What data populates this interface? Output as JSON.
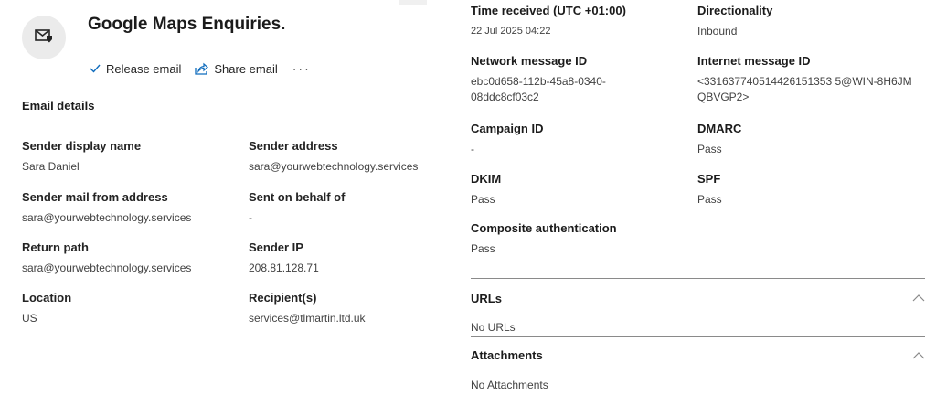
{
  "header": {
    "title": "Google Maps Enquiries.",
    "icon": "mail-shield-icon",
    "actions": {
      "release": "Release email",
      "share": "Share email",
      "more": "···"
    }
  },
  "email_details": {
    "heading": "Email details",
    "fields": {
      "sender_display_name": {
        "label": "Sender display name",
        "value": "Sara Daniel"
      },
      "sender_address": {
        "label": "Sender address",
        "value": "sara@yourwebtechnology.services"
      },
      "sender_mail_from": {
        "label": "Sender mail from address",
        "value": "sara@yourwebtechnology.services"
      },
      "sent_on_behalf": {
        "label": "Sent on behalf of",
        "value": "-"
      },
      "return_path": {
        "label": "Return path",
        "value": "sara@yourwebtechnology.services"
      },
      "sender_ip": {
        "label": "Sender IP",
        "value": "208.81.128.71"
      },
      "location": {
        "label": "Location",
        "value": "US"
      },
      "recipients": {
        "label": "Recipient(s)",
        "value": "services@tlmartin.ltd.uk"
      }
    }
  },
  "message_info": {
    "time_received": {
      "label": "Time received (UTC +01:00)",
      "value": "22 Jul 2025 04:22"
    },
    "directionality": {
      "label": "Directionality",
      "value": "Inbound"
    },
    "network_message_id": {
      "label": "Network message ID",
      "value": "ebc0d658-112b-45a8-0340-08ddc8cf03c2"
    },
    "internet_message_id": {
      "label": "Internet message ID",
      "value": "<331637740514426151353 5@WIN-8H6JMQBVGP2>"
    },
    "campaign_id": {
      "label": "Campaign ID",
      "value": "-"
    },
    "dmarc": {
      "label": "DMARC",
      "value": "Pass"
    },
    "dkim": {
      "label": "DKIM",
      "value": "Pass"
    },
    "spf": {
      "label": "SPF",
      "value": "Pass"
    },
    "composite_auth": {
      "label": "Composite authentication",
      "value": "Pass"
    }
  },
  "urls": {
    "heading": "URLs",
    "value": "No URLs"
  },
  "attachments": {
    "heading": "Attachments",
    "value": "No Attachments"
  },
  "colors": {
    "accent": "#0f6cbd",
    "divider": "#8a8a8a",
    "avatar_bg": "#ebebeb"
  }
}
